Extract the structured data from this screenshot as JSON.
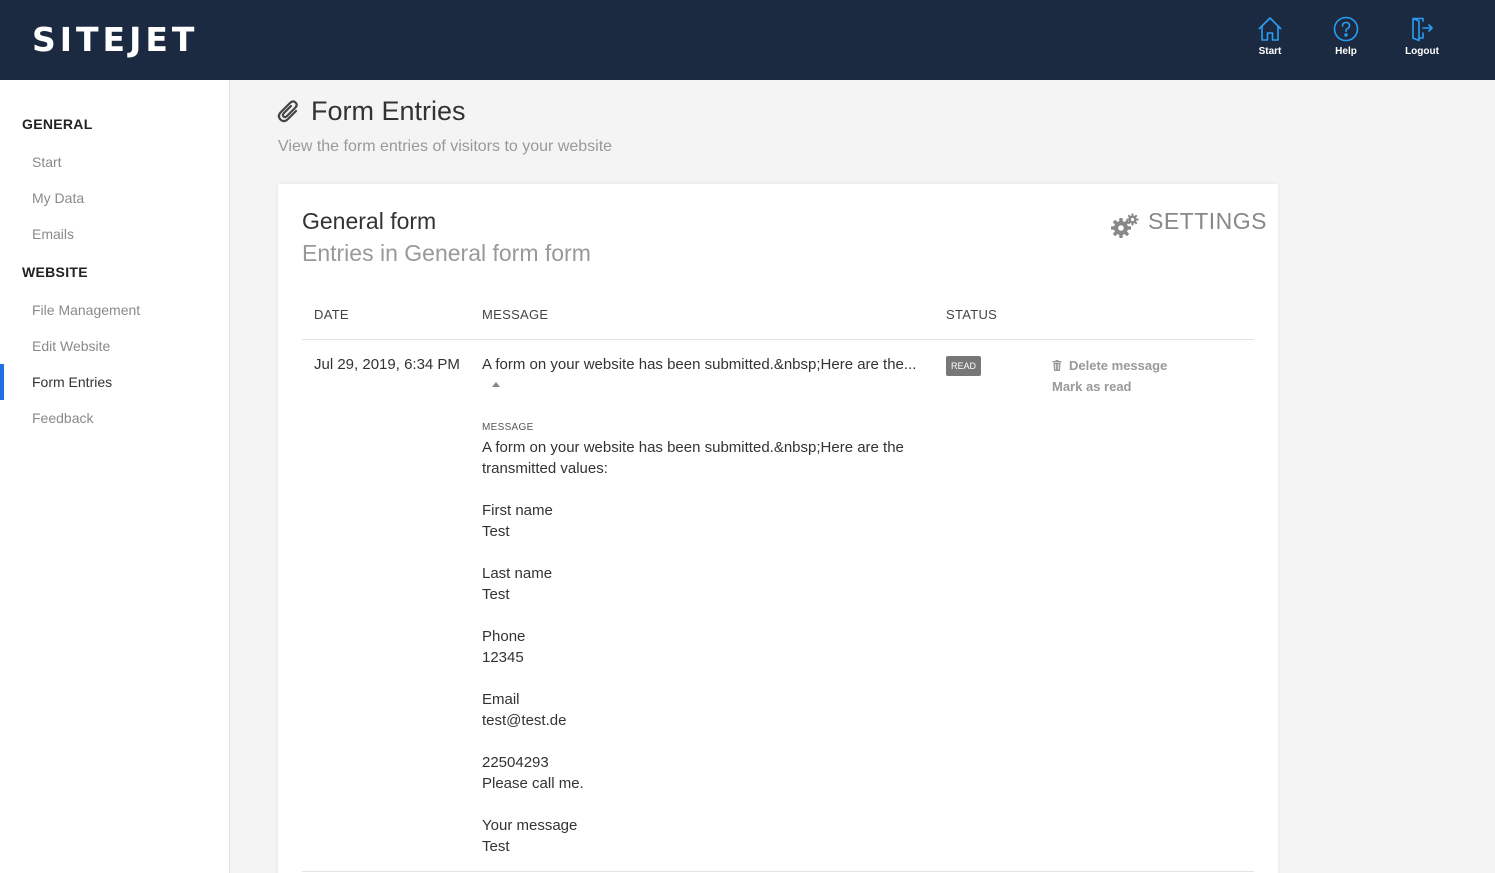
{
  "header": {
    "logo": "SITEJET",
    "nav": [
      {
        "label": "Start",
        "icon": "home-icon"
      },
      {
        "label": "Help",
        "icon": "help-icon"
      },
      {
        "label": "Logout",
        "icon": "logout-icon"
      }
    ]
  },
  "sidebar": {
    "general_heading": "GENERAL",
    "general_items": [
      "Start",
      "My Data",
      "Emails"
    ],
    "website_heading": "WEBSITE",
    "website_items": [
      "File Management",
      "Edit Website",
      "Form Entries",
      "Feedback"
    ],
    "active_item": "Form Entries"
  },
  "page": {
    "icon": "paperclip-icon",
    "title": "Form Entries",
    "subtitle": "View the form entries of visitors to your website"
  },
  "card": {
    "title": "General form",
    "subtitle": "Entries in General form form",
    "settings_label": "SETTINGS",
    "settings_icon": "gears-icon"
  },
  "table": {
    "headers": {
      "date": "DATE",
      "message": "MESSAGE",
      "status": "STATUS"
    },
    "row": {
      "date": "Jul 29, 2019, 6:34 PM",
      "message_preview": "A form on your website has been submitted.&nbsp;Here are the...",
      "status": "READ",
      "actions": {
        "delete": "Delete message",
        "mark_read": "Mark as read"
      },
      "detail_label": "MESSAGE",
      "detail_intro": "A form on your website has been submitted.&nbsp;Here are the transmitted values:",
      "fields": [
        {
          "name": "First name",
          "value": "Test"
        },
        {
          "name": "Last name",
          "value": "Test"
        },
        {
          "name": "Phone",
          "value": "12345"
        },
        {
          "name": "Email",
          "value": "test@test.de"
        },
        {
          "name": "22504293",
          "value": "Please call me."
        },
        {
          "name": "Your message",
          "value": "Test"
        }
      ]
    }
  },
  "colors": {
    "header_bg": "#1b2a41",
    "icon_blue": "#2a9df4",
    "active_accent": "#1e6fe0",
    "badge_bg": "#777777"
  }
}
